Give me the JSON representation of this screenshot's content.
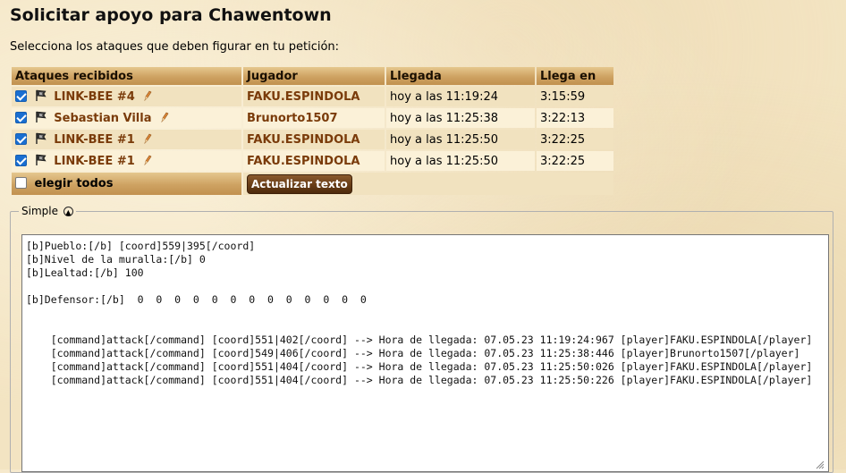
{
  "page": {
    "title": "Solicitar apoyo para Chawentown",
    "instructions": "Selecciona los ataques que deben figurar en tu petición:"
  },
  "table": {
    "headers": [
      "Ataques recibidos",
      "Jugador",
      "Llegada",
      "Llega en"
    ],
    "rows": [
      {
        "checked": true,
        "attack": "LINK-BEE #4",
        "player": "FAKU.ESPINDOLA",
        "arrival": "hoy a las 11:19:24",
        "arrives_in": "3:15:59"
      },
      {
        "checked": true,
        "attack": "Sebastian Villa",
        "player": "Brunorto1507",
        "arrival": "hoy a las 11:25:38",
        "arrives_in": "3:22:13"
      },
      {
        "checked": true,
        "attack": "LINK-BEE #1",
        "player": "FAKU.ESPINDOLA",
        "arrival": "hoy a las 11:25:50",
        "arrives_in": "3:22:25"
      },
      {
        "checked": true,
        "attack": "LINK-BEE #1",
        "player": "FAKU.ESPINDOLA",
        "arrival": "hoy a las 11:25:50",
        "arrives_in": "3:22:25"
      }
    ],
    "select_all_label": "elegir todos",
    "select_all_checked": false,
    "update_button_label": "Actualizar texto"
  },
  "simple": {
    "legend": "Simple",
    "toggle_icon": "collapse-up-icon",
    "text": "[b]Pueblo:[/b] [coord]559|395[/coord]\n[b]Nivel de la muralla:[/b] 0\n[b]Lealtad:[/b] 100\n\n[b]Defensor:[/b]  0  0  0  0  0  0  0  0  0  0  0  0  0\n\n\n    [command]attack[/command] [coord]551|402[/coord] --> Hora de llegada: 07.05.23 11:19:24:967 [player]FAKU.ESPINDOLA[/player]\n    [command]attack[/command] [coord]549|406[/coord] --> Hora de llegada: 07.05.23 11:25:38:446 [player]Brunorto1507[/player]\n    [command]attack[/command] [coord]551|404[/coord] --> Hora de llegada: 07.05.23 11:25:50:026 [player]FAKU.ESPINDOLA[/player]\n    [command]attack[/command] [coord]551|404[/coord] --> Hora de llegada: 07.05.23 11:25:50:226 [player]FAKU.ESPINDOLA[/player]"
  },
  "colors": {
    "background": "#f3e4c2",
    "header_gradient_top": "#e5c78e",
    "header_gradient_bottom": "#c1914f",
    "row_odd": "#f1e2bf",
    "row_even": "#fbf1d8",
    "link_text": "#7a3b0a",
    "checkbox_accent": "#1a6fd1",
    "button_bg": "#6b3f18"
  }
}
